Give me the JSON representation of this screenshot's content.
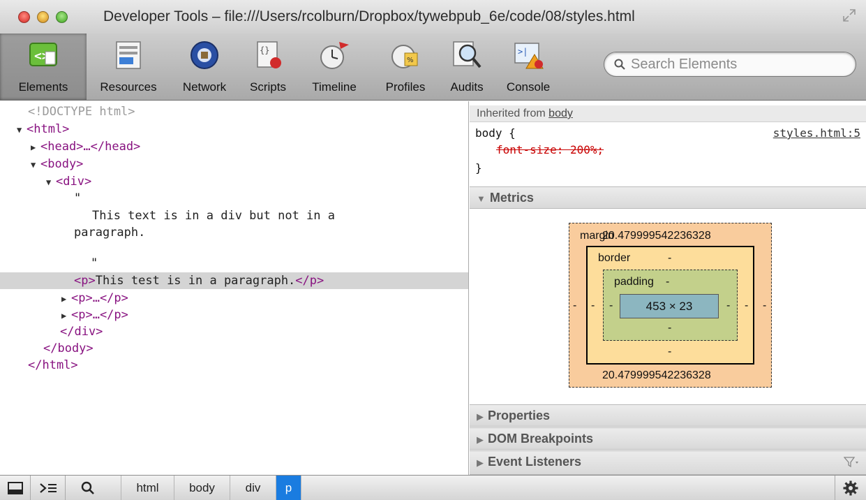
{
  "window": {
    "title": "Developer Tools – file:///Users/rcolburn/Dropbox/tywebpub_6e/code/08/styles.html"
  },
  "toolbar": {
    "tabs": [
      {
        "label": "Elements",
        "icon": "elements-icon",
        "active": true
      },
      {
        "label": "Resources",
        "icon": "resources-icon"
      },
      {
        "label": "Network",
        "icon": "network-icon"
      },
      {
        "label": "Scripts",
        "icon": "scripts-icon"
      },
      {
        "label": "Timeline",
        "icon": "timeline-icon"
      },
      {
        "label": "Profiles",
        "icon": "profiles-icon"
      },
      {
        "label": "Audits",
        "icon": "audits-icon"
      },
      {
        "label": "Console",
        "icon": "console-icon"
      }
    ],
    "search_placeholder": "Search Elements"
  },
  "dom": {
    "doctype": "<!DOCTYPE html>",
    "html_open": "<html>",
    "head_collapsed": "<head>…</head>",
    "body_open": "<body>",
    "div_open": "<div>",
    "quote1": "\"",
    "text_line1": "This text is in a div but not in a",
    "text_line2": "paragraph.",
    "quote2": "\"",
    "p_open": "<p>",
    "p_text": "This test is in a paragraph.",
    "p_close": "</p>",
    "p_collapsed": "<p>…</p>",
    "div_close": "</div>",
    "body_close": "</body>",
    "html_close": "</html>"
  },
  "styles": {
    "inherited_prefix": "Inherited from",
    "inherited_element": "body",
    "selector": "body {",
    "property": "font-size: 200%;",
    "close_brace": "}",
    "source": "styles.html:5"
  },
  "metrics": {
    "header": "Metrics",
    "margin_label": "margin",
    "margin_top": "20.479999542236328",
    "margin_bottom": "20.479999542236328",
    "margin_left": "-",
    "margin_right": "-",
    "border_label": "border",
    "border_top": "-",
    "border_bottom": "-",
    "border_left": "-",
    "border_right": "-",
    "padding_label": "padding",
    "padding_top": "-",
    "padding_bottom": "-",
    "padding_left": "-",
    "padding_right": "-",
    "content_size": "453 × 23"
  },
  "sections": {
    "properties": "Properties",
    "dom_breakpoints": "DOM Breakpoints",
    "event_listeners": "Event Listeners"
  },
  "breadcrumbs": [
    "html",
    "body",
    "div",
    "p"
  ],
  "colors": {
    "tag": "#881280",
    "selected_crumb": "#1a7ce0",
    "margin_box": "#f9cc9d",
    "border_box": "#fddd9b",
    "padding_box": "#c3d08b",
    "content_box": "#8cb6c0"
  }
}
